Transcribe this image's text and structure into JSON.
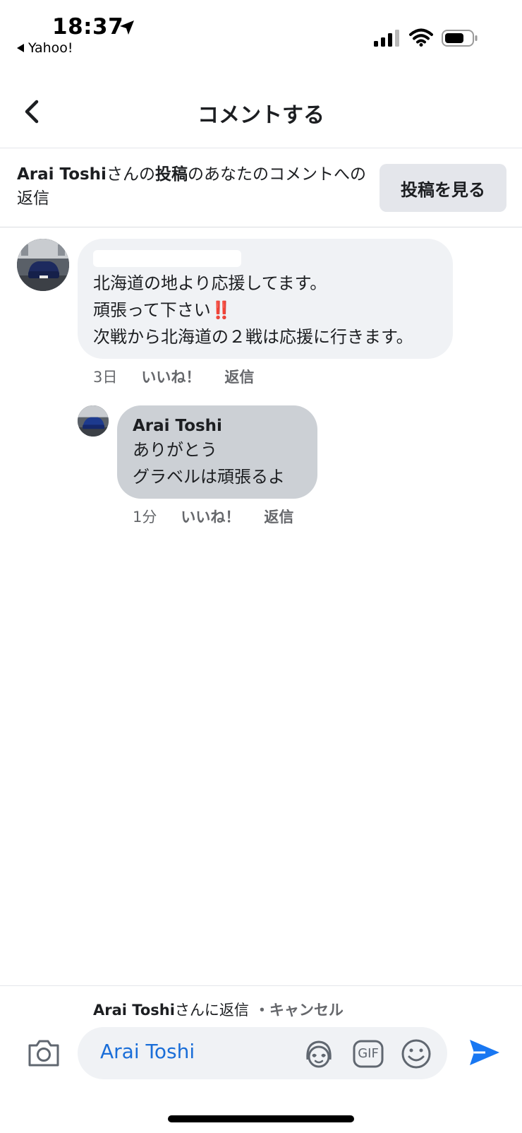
{
  "status_bar": {
    "time": "18:37",
    "back_app": "Yahoo!"
  },
  "nav": {
    "title": "コメントする"
  },
  "context": {
    "author": "Arai Toshi",
    "san_no": "さんの",
    "post_word": "投稿",
    "rest": "のあなたのコメントへの返信",
    "view_post_label": "投稿を見る"
  },
  "comments": [
    {
      "line1": "北海道の地より応援してます。",
      "line2": "頑張って下さい",
      "line2_emoji": "‼️",
      "line3": "次戦から北海道の２戦は応援に行きます。",
      "time": "3日",
      "like_label": "いいね！",
      "reply_label": "返信"
    },
    {
      "author": "Arai Toshi",
      "line1": "ありがとう",
      "line2": "グラベルは頑張るよ",
      "time": "1分",
      "like_label": "いいね！",
      "reply_label": "返信"
    }
  ],
  "reply_bar": {
    "target_name": "Arai Toshi",
    "target_suffix": "さんに返信",
    "cancel_label": "・キャンセル",
    "input_value": "Arai Toshi",
    "gif_label": "GIF"
  },
  "colors": {
    "accent": "#1877f2",
    "bubble": "#f0f2f5",
    "reply_bubble": "#ccd0d5"
  },
  "icons": [
    "location-arrow-icon",
    "signal-icon",
    "wifi-icon",
    "battery-icon",
    "chevron-left-icon",
    "camera-icon",
    "avatar-sticker-icon",
    "gif-icon",
    "emoji-icon",
    "send-icon"
  ]
}
